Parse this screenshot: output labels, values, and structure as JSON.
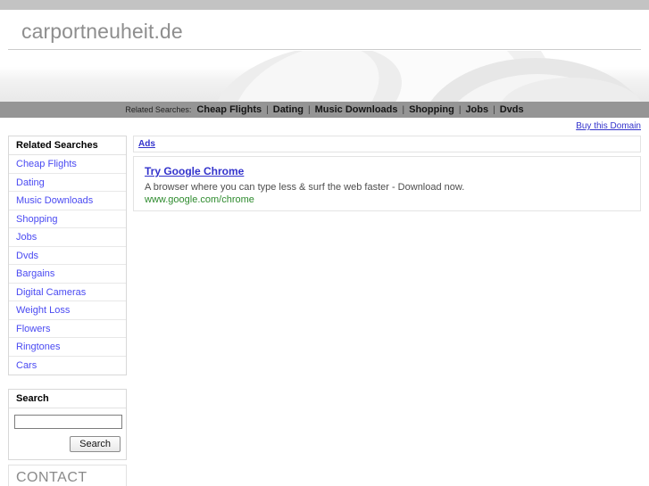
{
  "header": {
    "domain_title": "carportneuheit.de"
  },
  "nav": {
    "label": "Related Searches:",
    "separator": "|",
    "links": [
      "Cheap Flights",
      "Dating",
      "Music Downloads",
      "Shopping",
      "Jobs",
      "Dvds"
    ]
  },
  "buy_domain": {
    "label": "Buy this Domain"
  },
  "sidebar": {
    "related": {
      "title": "Related Searches",
      "items": [
        "Cheap Flights",
        "Dating",
        "Music Downloads",
        "Shopping",
        "Jobs",
        "Dvds",
        "Bargains",
        "Digital Cameras",
        "Weight Loss",
        "Flowers",
        "Ringtones",
        "Cars"
      ]
    },
    "search": {
      "title": "Search",
      "input_value": "",
      "input_placeholder": "",
      "button_label": "Search"
    },
    "contact": {
      "title": "CONTACT"
    }
  },
  "main": {
    "ads_label": "Ads",
    "ads": [
      {
        "title": "Try Google Chrome",
        "description": "A browser where you can type less & surf the web faster - Download now.",
        "url": "www.google.com/chrome"
      }
    ]
  },
  "colors": {
    "topbar": "#c3c3c3",
    "navbar": "#959595",
    "link_blue": "#3333cc",
    "sidebar_link": "#4a4af2",
    "ad_url_green": "#2e8b2e",
    "title_gray": "#8e8e8e"
  }
}
